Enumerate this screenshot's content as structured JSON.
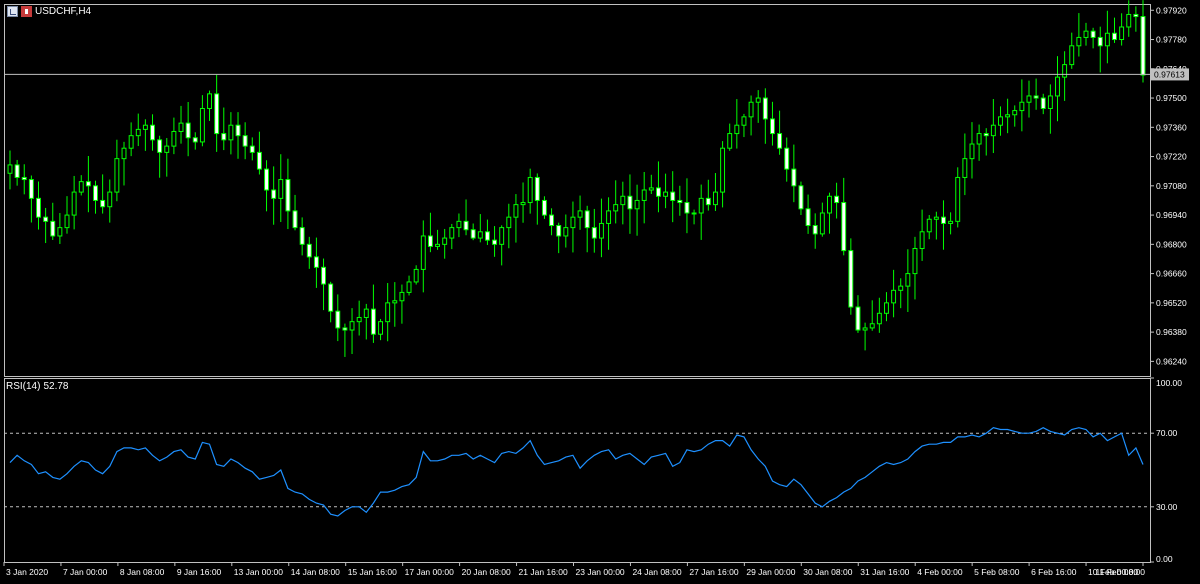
{
  "header": {
    "symbol_label": "USDCHF,H4",
    "icons": [
      "chart-window-icon",
      "flag-icon"
    ]
  },
  "rsi_panel": {
    "name": "RSI(14)",
    "value": "52.78"
  },
  "colors": {
    "background": "#000000",
    "bull_candle": "#000000",
    "bear_candle": "#ffffff",
    "candle_outline": "#00ff00",
    "rsi_line": "#1e90ff",
    "level_lines": "#c0c0c0",
    "price_line": "#c0c0c0",
    "current_price_box": "#c0c0c0"
  },
  "chart_data": [
    {
      "type": "candlestick",
      "title": "USDCHF,H4",
      "ylim": [
        0.9617,
        0.9795
      ],
      "y_ticks": [
        "0.97920",
        "0.97780",
        "0.97640",
        "0.97500",
        "0.97360",
        "0.97220",
        "0.97080",
        "0.96940",
        "0.96800",
        "0.96660",
        "0.96520",
        "0.96380",
        "0.96240"
      ],
      "current_price": "0.97613",
      "x_ticks": [
        "3 Jan 2020",
        "7 Jan 00:00",
        "8 Jan 08:00",
        "9 Jan 16:00",
        "13 Jan 00:00",
        "14 Jan 08:00",
        "15 Jan 16:00",
        "17 Jan 00:00",
        "20 Jan 08:00",
        "21 Jan 16:00",
        "23 Jan 00:00",
        "24 Jan 08:00",
        "27 Jan 16:00",
        "29 Jan 00:00",
        "30 Jan 08:00",
        "31 Jan 16:00",
        "4 Feb 00:00",
        "5 Feb 08:00",
        "6 Feb 16:00",
        "10 Feb 00:00",
        "11 Feb 08:00"
      ],
      "close_series": [
        0.9718,
        0.9712,
        0.9711,
        0.9702,
        0.9693,
        0.9691,
        0.9684,
        0.9688,
        0.9694,
        0.9705,
        0.971,
        0.9708,
        0.9701,
        0.9698,
        0.9705,
        0.9721,
        0.9726,
        0.9732,
        0.9735,
        0.9737,
        0.973,
        0.9724,
        0.9727,
        0.9734,
        0.9738,
        0.9731,
        0.9729,
        0.9745,
        0.9752,
        0.9733,
        0.973,
        0.9737,
        0.9732,
        0.9727,
        0.9724,
        0.9716,
        0.9706,
        0.9702,
        0.9711,
        0.9696,
        0.9688,
        0.968,
        0.9674,
        0.9669,
        0.9661,
        0.9648,
        0.964,
        0.9639,
        0.9643,
        0.9645,
        0.9649,
        0.9637,
        0.9643,
        0.9652,
        0.9653,
        0.9657,
        0.9662,
        0.9668,
        0.9684,
        0.9679,
        0.968,
        0.9683,
        0.9688,
        0.9691,
        0.9687,
        0.9683,
        0.9686,
        0.9682,
        0.968,
        0.9688,
        0.9693,
        0.9699,
        0.97,
        0.9712,
        0.9701,
        0.9694,
        0.9689,
        0.9684,
        0.9688,
        0.9693,
        0.9696,
        0.9688,
        0.9683,
        0.969,
        0.9696,
        0.9699,
        0.9703,
        0.9697,
        0.9701,
        0.9706,
        0.9707,
        0.9703,
        0.9705,
        0.9701,
        0.97,
        0.9695,
        0.9695,
        0.9702,
        0.9699,
        0.9705,
        0.9726,
        0.9733,
        0.9737,
        0.9741,
        0.9748,
        0.975,
        0.974,
        0.9733,
        0.9726,
        0.9716,
        0.9708,
        0.9697,
        0.9689,
        0.9685,
        0.9695,
        0.9703,
        0.97,
        0.9677,
        0.965,
        0.9639,
        0.964,
        0.9642,
        0.9647,
        0.9652,
        0.9658,
        0.966,
        0.9666,
        0.9678,
        0.9686,
        0.9692,
        0.9693,
        0.969,
        0.9691,
        0.9712,
        0.9721,
        0.9728,
        0.9733,
        0.9732,
        0.9737,
        0.9741,
        0.9742,
        0.9744,
        0.9748,
        0.9751,
        0.975,
        0.9745,
        0.9751,
        0.976,
        0.9766,
        0.9775,
        0.9779,
        0.9782,
        0.9779,
        0.9775,
        0.9781,
        0.9778,
        0.9784,
        0.979,
        0.9789,
        0.9761
      ]
    },
    {
      "type": "line",
      "title": "RSI(14) 52.78",
      "ylim": [
        0,
        100
      ],
      "y_ticks": [
        "100.00",
        "70.00",
        "30.00",
        "0.00"
      ],
      "levels": [
        70,
        30
      ],
      "series": [
        {
          "values": [
            54,
            58,
            55,
            53,
            48,
            49,
            46,
            45,
            48,
            52,
            55,
            54,
            50,
            48,
            52,
            60,
            62,
            62,
            61,
            62,
            58,
            55,
            57,
            60,
            61,
            57,
            56,
            65,
            64,
            53,
            52,
            56,
            54,
            51,
            49,
            45,
            46,
            47,
            50,
            40,
            38,
            37,
            34,
            32,
            31,
            26,
            25,
            28,
            30,
            30,
            27,
            32,
            38,
            38,
            39,
            41,
            42,
            46,
            60,
            55,
            55,
            56,
            58,
            58,
            59,
            56,
            58,
            56,
            54,
            59,
            60,
            59,
            62,
            66,
            58,
            53,
            54,
            55,
            57,
            58,
            51,
            55,
            58,
            60,
            61,
            56,
            58,
            59,
            56,
            53,
            57,
            58,
            59,
            52,
            54,
            61,
            60,
            61,
            64,
            66,
            66,
            63,
            69,
            68,
            61,
            56,
            52,
            44,
            42,
            41,
            45,
            42,
            37,
            32,
            30,
            33,
            35,
            38,
            40,
            44,
            46,
            49,
            52,
            54,
            53,
            54,
            56,
            60,
            63,
            64,
            64,
            65,
            65,
            68,
            68,
            69,
            68,
            70,
            73,
            72,
            72,
            71,
            70,
            70,
            71,
            73,
            71,
            70,
            69,
            72,
            73,
            72,
            68,
            70,
            66,
            68,
            70,
            58,
            62,
            53
          ]
        }
      ]
    }
  ]
}
